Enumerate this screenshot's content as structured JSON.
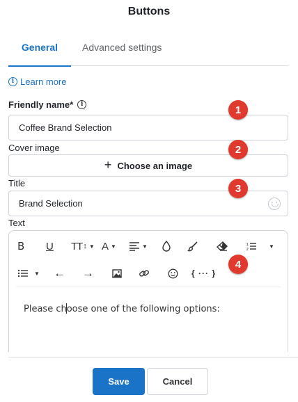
{
  "dialog": {
    "title": "Buttons"
  },
  "tabs": [
    {
      "label": "General",
      "active": true
    },
    {
      "label": "Advanced settings",
      "active": false
    }
  ],
  "learn_more": "Learn more",
  "fields": {
    "friendly_name": {
      "label": "Friendly name*",
      "value": "Coffee Brand Selection"
    },
    "cover_image": {
      "label": "Cover image",
      "button_label": "Choose an image"
    },
    "title": {
      "label": "Title",
      "value": "Brand Selection"
    },
    "text": {
      "label": "Text",
      "value_before_cursor": "Please ch",
      "value_after_cursor": "oose one of the following options:"
    }
  },
  "toolbar": {
    "bold": "B",
    "underline": "U",
    "font_size": "TT",
    "font_color": "A",
    "code_block": "{ ··· }"
  },
  "annotations": [
    "1",
    "2",
    "3",
    "4"
  ],
  "footer": {
    "save_label": "Save",
    "cancel_label": "Cancel"
  },
  "colors": {
    "accent": "#1a73c7",
    "badge": "#e03a2f",
    "border": "#cfd4da"
  }
}
